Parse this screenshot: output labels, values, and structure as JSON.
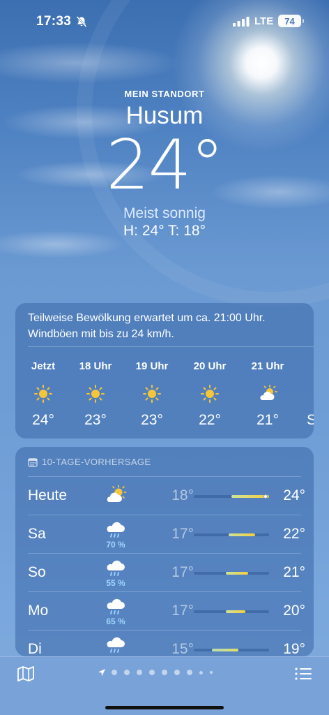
{
  "status_bar": {
    "time": "17:33",
    "network": "LTE",
    "battery": "74"
  },
  "hero": {
    "location_label": "MEIN STANDORT",
    "city": "Husum",
    "temperature": "24°",
    "condition": "Meist sonnig",
    "high_low": "H: 24°  T: 18°"
  },
  "hourly": {
    "description": "Teilweise Bewölkung erwartet um ca. 21:00 Uhr. Windböen mit bis zu 24 km/h.",
    "hours": [
      {
        "label": "Jetzt",
        "icon": "sun-icon",
        "temp": "24°"
      },
      {
        "label": "18 Uhr",
        "icon": "sun-icon",
        "temp": "23°"
      },
      {
        "label": "19 Uhr",
        "icon": "sun-icon",
        "temp": "23°"
      },
      {
        "label": "20 Uhr",
        "icon": "sun-icon",
        "temp": "22°"
      },
      {
        "label": "21 Uhr",
        "icon": "partly-cloudy-icon",
        "temp": "21°"
      },
      {
        "label": "",
        "icon": "",
        "temp": "S"
      }
    ]
  },
  "daily": {
    "header": "10-TAGE-VORHERSAGE",
    "days": [
      {
        "name": "Heute",
        "icon": "partly-cloudy-icon",
        "pop": "",
        "low": "18°",
        "high": "24°"
      },
      {
        "name": "Sa",
        "icon": "rain-cloud-icon",
        "pop": "70 %",
        "low": "17°",
        "high": "22°"
      },
      {
        "name": "So",
        "icon": "rain-cloud-icon",
        "pop": "55 %",
        "low": "17°",
        "high": "21°"
      },
      {
        "name": "Mo",
        "icon": "rain-cloud-icon",
        "pop": "65 %",
        "low": "17°",
        "high": "20°"
      },
      {
        "name": "Di",
        "icon": "rain-cloud-icon",
        "pop": "",
        "low": "15°",
        "high": "19°"
      }
    ]
  },
  "bottom_bar": {
    "map_icon": "map-icon",
    "list_icon": "list-icon",
    "current_page_icon": "location-arrow-icon"
  },
  "colors": {
    "sun": "#f6c63a",
    "precip": "#9fd6ff",
    "bar_warm": "#f4cf3e",
    "bar_cool": "#cfe39a"
  }
}
